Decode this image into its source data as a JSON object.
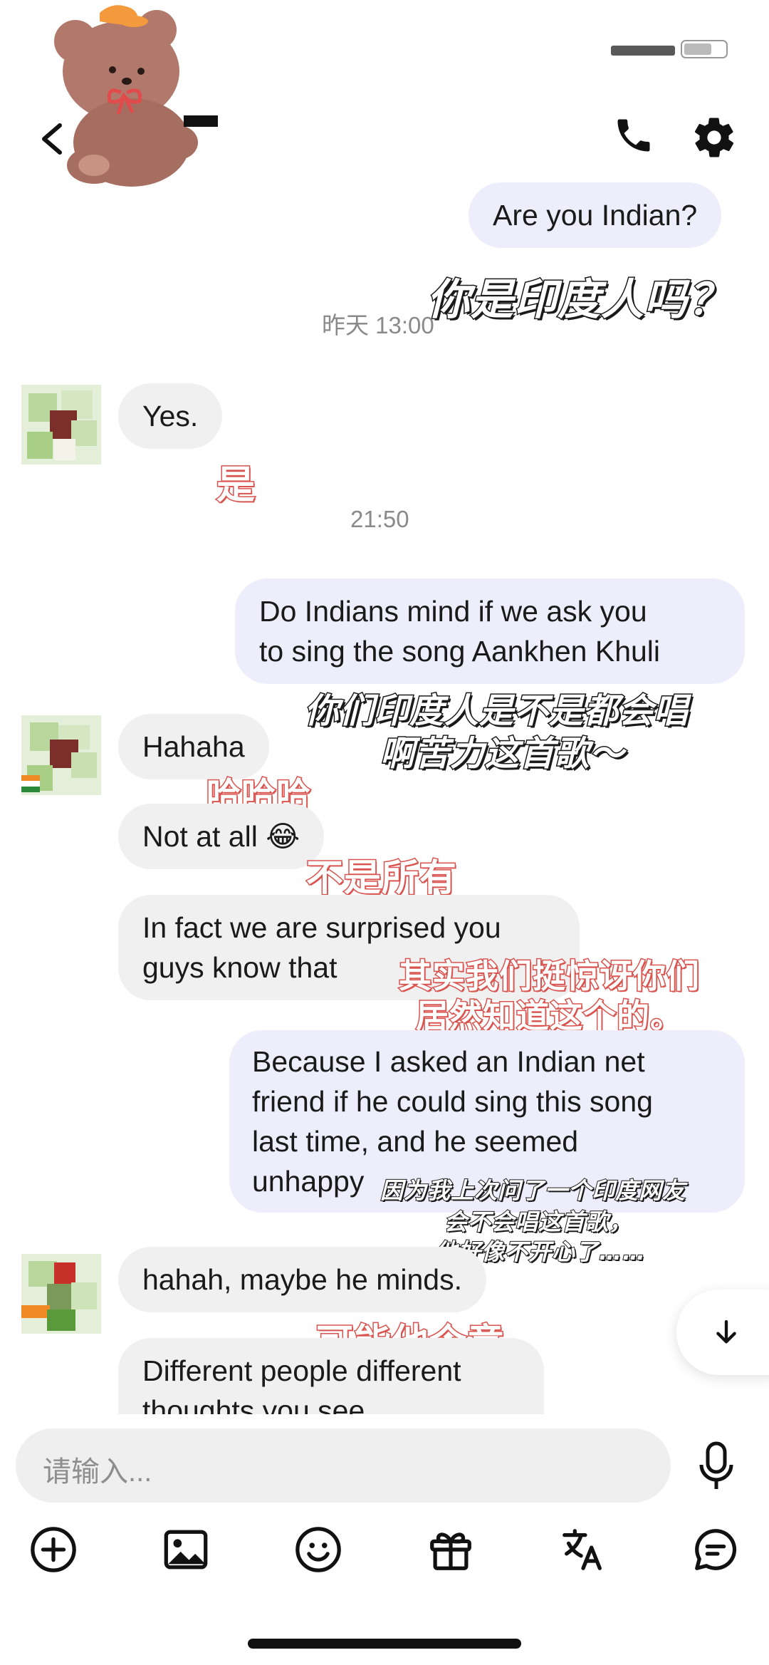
{
  "header": {
    "back_icon": "chevron-left-icon",
    "avatar_icon": "teddy-bear-sticker",
    "call_icon": "phone-icon",
    "settings_icon": "gear-icon"
  },
  "messages": [
    {
      "side": "out",
      "text": "Are you Indian?",
      "caption": "你是印度人吗？"
    },
    {
      "time": "昨天 13:00"
    },
    {
      "side": "in",
      "text": "Yes.",
      "caption": "是"
    },
    {
      "time": "21:50"
    },
    {
      "side": "out",
      "line1": "Do Indians mind if we ask you",
      "line2": "to sing the song Aankhen Khuli",
      "caption1": "你们印度人是不是都会唱",
      "caption2": "啊苦力这首歌～"
    },
    {
      "side": "in",
      "text": "Hahaha",
      "caption": "哈哈哈"
    },
    {
      "side": "in",
      "text": "Not at all 😂",
      "caption": "不是所有"
    },
    {
      "side": "in",
      "line1": "In fact we are surprised you",
      "line2": "guys know that",
      "caption1": "其实我们挺惊讶你们",
      "caption2": "居然知道这个的。"
    },
    {
      "side": "out",
      "line1": "Because I asked an Indian net",
      "line2": "friend if he could sing this song",
      "line3": "last time, and he seemed",
      "line4": "unhappy",
      "caption1": "因为我上次问了一个印度网友",
      "caption2": "会不会唱这首歌，",
      "caption3": "他好像不开心了……"
    },
    {
      "side": "in",
      "text": "hahah, maybe he minds.",
      "caption": "可能他介意"
    },
    {
      "side": "in",
      "line1": "Different people different",
      "line2": "thoughts you see"
    }
  ],
  "scroll_down_icon": "arrow-down-icon",
  "composer": {
    "placeholder": "请输入...",
    "mic_icon": "microphone-icon"
  },
  "toolbar": [
    "add-icon",
    "image-icon",
    "emoji-icon",
    "gift-icon",
    "translate-icon",
    "chat-bubble-icon"
  ]
}
